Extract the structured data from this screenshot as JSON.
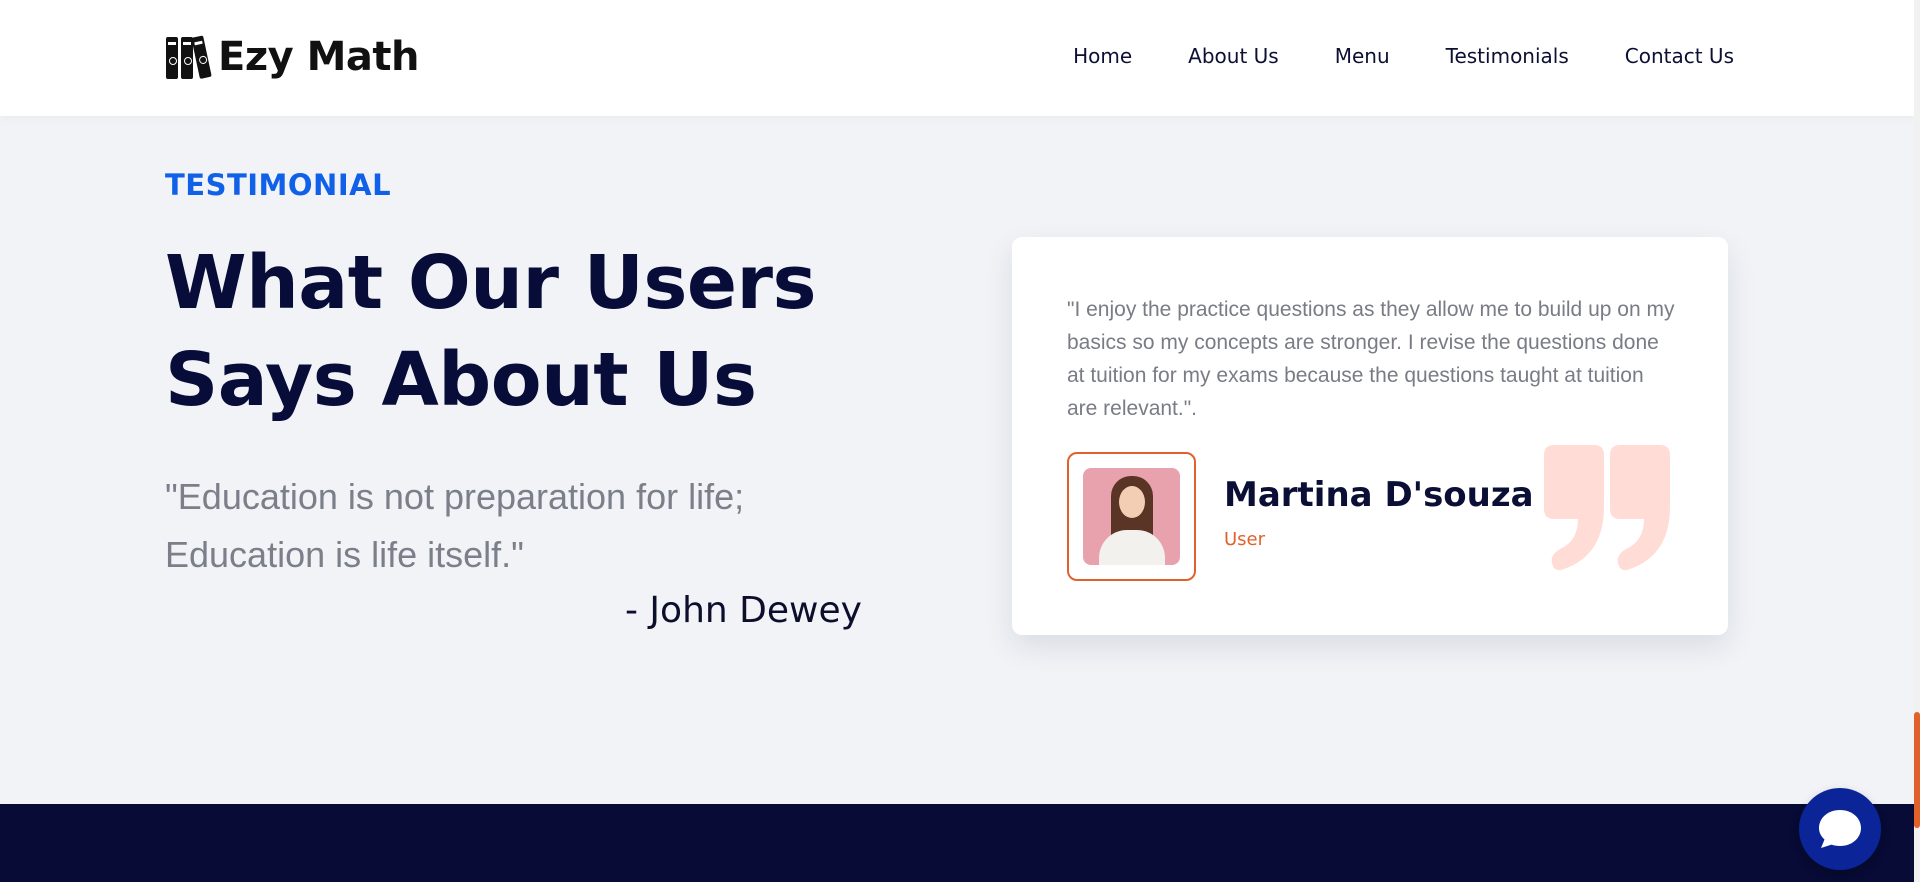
{
  "header": {
    "brand": "Ezy Math",
    "nav": [
      "Home",
      "About Us",
      "Menu",
      "Testimonials",
      "Contact Us"
    ]
  },
  "section": {
    "eyebrow": "TESTIMONIAL",
    "heading_line1": "What Our Users",
    "heading_line2": "Says About Us",
    "quote_line1": "\"Education is not preparation for life;",
    "quote_line2": "Education is life itself.\"",
    "quote_author": "- John Dewey"
  },
  "testimonial": {
    "text": "\"I enjoy the practice questions as they allow me to build up on my basics so my concepts are stronger. I revise the questions done at tuition for my exams because the questions taught at tuition are relevant.\".",
    "name": "Martina D'souza",
    "role": "User"
  },
  "colors": {
    "accent_blue": "#1161e8",
    "accent_orange": "#e0622a",
    "navy": "#080c38",
    "quote_mark": "#ffddd6"
  },
  "icons": {
    "logo": "books-icon",
    "quote": "quote-mark-icon",
    "chat": "chat-bubble-icon"
  }
}
